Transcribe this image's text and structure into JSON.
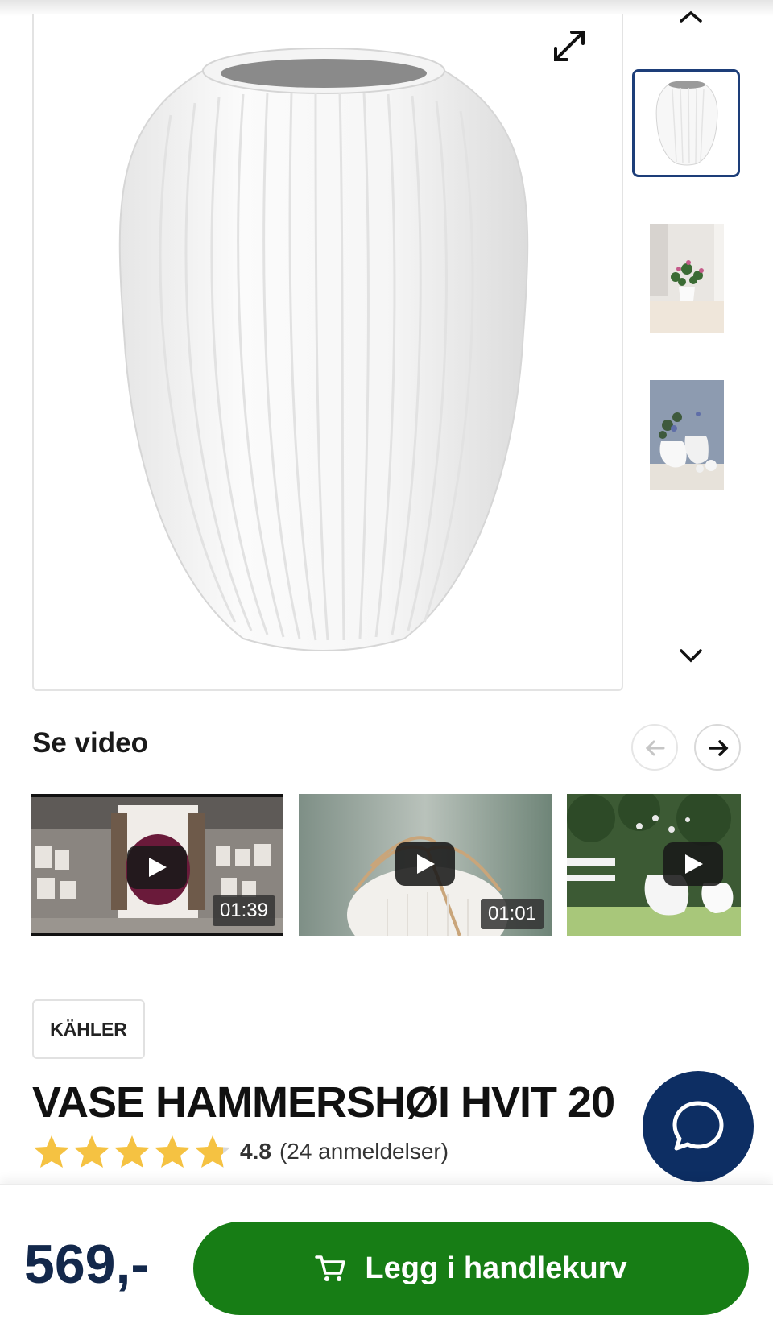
{
  "gallery": {
    "main_image_alt": "Vase Hammershøi hvit",
    "thumbnails": [
      {
        "icon": "vase-thumbnail",
        "active": true
      },
      {
        "icon": "flowers-table-thumbnail",
        "active": false
      },
      {
        "icon": "vases-shelf-thumbnail",
        "active": false
      }
    ]
  },
  "video_section": {
    "title": "Se video",
    "videos": [
      {
        "duration": "01:39"
      },
      {
        "duration": "01:01"
      },
      {
        "duration": ""
      }
    ]
  },
  "product": {
    "brand": "KÄHLER",
    "title": "VASE HAMMERSHØI HVIT 20",
    "rating": 4.8,
    "rating_label": "4.8",
    "reviews_label": "(24 anmeldelser)"
  },
  "purchase": {
    "price": "569,-",
    "add_to_cart_label": "Legg i handlekurv"
  },
  "colors": {
    "accent_green": "#177d15",
    "navy": "#13284b",
    "chat_bg": "#0d2e63",
    "star_yellow": "#f5c242",
    "thumb_border": "#1d3e79"
  }
}
